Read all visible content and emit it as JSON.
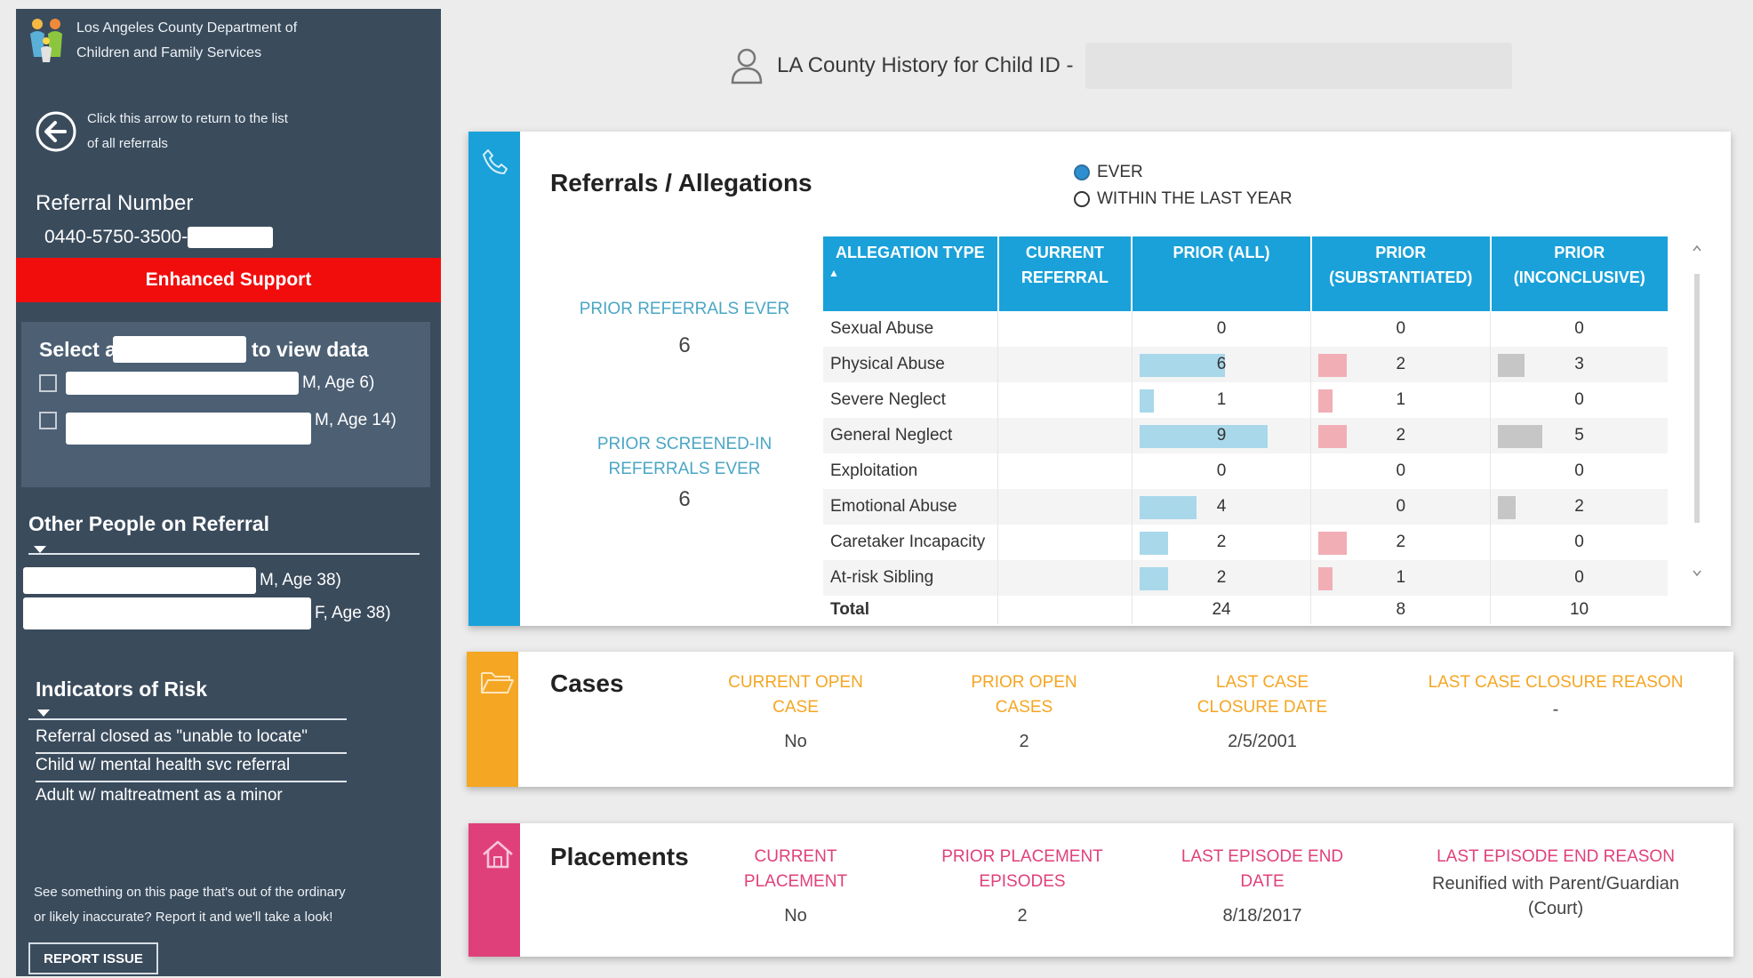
{
  "sidebar": {
    "brand_line1": "Los Angeles County Department of",
    "brand_line2": "Children and Family Services",
    "back_line1": "Click this arrow to return to the list",
    "back_line2": "of all referrals",
    "referral_label": "Referral Number",
    "referral_number": "0440-5750-3500-",
    "enhanced_label": "Enhanced Support",
    "select_prefix": "Select a",
    "select_suffix": "to view data",
    "children": [
      {
        "suffix": "M, Age 6)",
        "checked": false
      },
      {
        "suffix": "M, Age 14)",
        "checked": false
      }
    ],
    "other_people_title": "Other People on Referral",
    "other_people": [
      {
        "suffix": "M, Age 38)"
      },
      {
        "suffix": "F, Age 38)"
      }
    ],
    "risk_title": "Indicators of Risk",
    "risks": [
      "Referral closed as \"unable to locate\"",
      "Child w/ mental health svc referral",
      "Adult w/ maltreatment as a minor"
    ],
    "report_line1": "See something on this page that's out of the ordinary",
    "report_line2": "or likely inaccurate? Report it and we'll take a look!",
    "report_button": "REPORT ISSUE"
  },
  "header": {
    "title": "LA County History for Child ID -"
  },
  "referrals": {
    "title": "Referrals / Allegations",
    "filter_options": [
      {
        "label": "EVER",
        "selected": true
      },
      {
        "label": "WITHIN THE LAST YEAR",
        "selected": false
      }
    ],
    "prior_referrals_label": "PRIOR REFERRALS EVER",
    "prior_referrals_value": "6",
    "prior_screened_label_1": "PRIOR SCREENED-IN",
    "prior_screened_label_2": "REFERRALS EVER",
    "prior_screened_value": "6",
    "columns": [
      [
        "ALLEGATION TYPE"
      ],
      [
        "CURRENT",
        "REFERRAL"
      ],
      [
        "PRIOR (ALL)"
      ],
      [
        "PRIOR",
        "(SUBSTANTIATED)"
      ],
      [
        "PRIOR",
        "(INCONCLUSIVE)"
      ]
    ],
    "rows": [
      {
        "type": "Sexual Abuse",
        "current": "",
        "prior_all": 0,
        "substantiated": 0,
        "inconclusive": 0
      },
      {
        "type": "Physical Abuse",
        "current": "",
        "prior_all": 6,
        "substantiated": 2,
        "inconclusive": 3
      },
      {
        "type": "Severe Neglect",
        "current": "",
        "prior_all": 1,
        "substantiated": 1,
        "inconclusive": 0
      },
      {
        "type": "General Neglect",
        "current": "",
        "prior_all": 9,
        "substantiated": 2,
        "inconclusive": 5
      },
      {
        "type": "Exploitation",
        "current": "",
        "prior_all": 0,
        "substantiated": 0,
        "inconclusive": 0
      },
      {
        "type": "Emotional Abuse",
        "current": "",
        "prior_all": 4,
        "substantiated": 0,
        "inconclusive": 2
      },
      {
        "type": "Caretaker Incapacity",
        "current": "",
        "prior_all": 2,
        "substantiated": 2,
        "inconclusive": 0
      },
      {
        "type": "At-risk Sibling",
        "current": "",
        "prior_all": 2,
        "substantiated": 1,
        "inconclusive": 0
      }
    ],
    "total": {
      "label": "Total",
      "current": "",
      "prior_all": "24",
      "substantiated": "8",
      "inconclusive": "10"
    },
    "bar_colors": {
      "prior_all": "#a8d8ea",
      "substantiated": "#f2aeb5",
      "inconclusive": "#c6c6c6"
    },
    "accent_color": "#1aa1d9"
  },
  "cases": {
    "title": "Cases",
    "accent_color": "#f5a623",
    "metrics": [
      {
        "label_1": "CURRENT OPEN",
        "label_2": "CASE",
        "value": "No"
      },
      {
        "label_1": "PRIOR OPEN",
        "label_2": "CASES",
        "value": "2"
      },
      {
        "label_1": "LAST CASE",
        "label_2": "CLOSURE DATE",
        "value": "2/5/2001"
      },
      {
        "label_1": "LAST CASE CLOSURE REASON",
        "label_2": "",
        "value": "-"
      }
    ]
  },
  "placements": {
    "title": "Placements",
    "accent_color": "#e0407a",
    "metrics": [
      {
        "label_1": "CURRENT",
        "label_2": "PLACEMENT",
        "value": "No"
      },
      {
        "label_1": "PRIOR PLACEMENT",
        "label_2": "EPISODES",
        "value": "2"
      },
      {
        "label_1": "LAST EPISODE END",
        "label_2": "DATE",
        "value": "8/18/2017"
      },
      {
        "label_1": "LAST EPISODE END REASON",
        "label_2": "",
        "value": "Reunified with Parent/Guardian",
        "value_2": "(Court)"
      }
    ]
  },
  "icons": {
    "logo": "family-logo-icon",
    "back": "back-arrow-icon",
    "person": "person-icon",
    "phone": "phone-icon",
    "folder": "folder-icon",
    "home": "home-icon"
  }
}
